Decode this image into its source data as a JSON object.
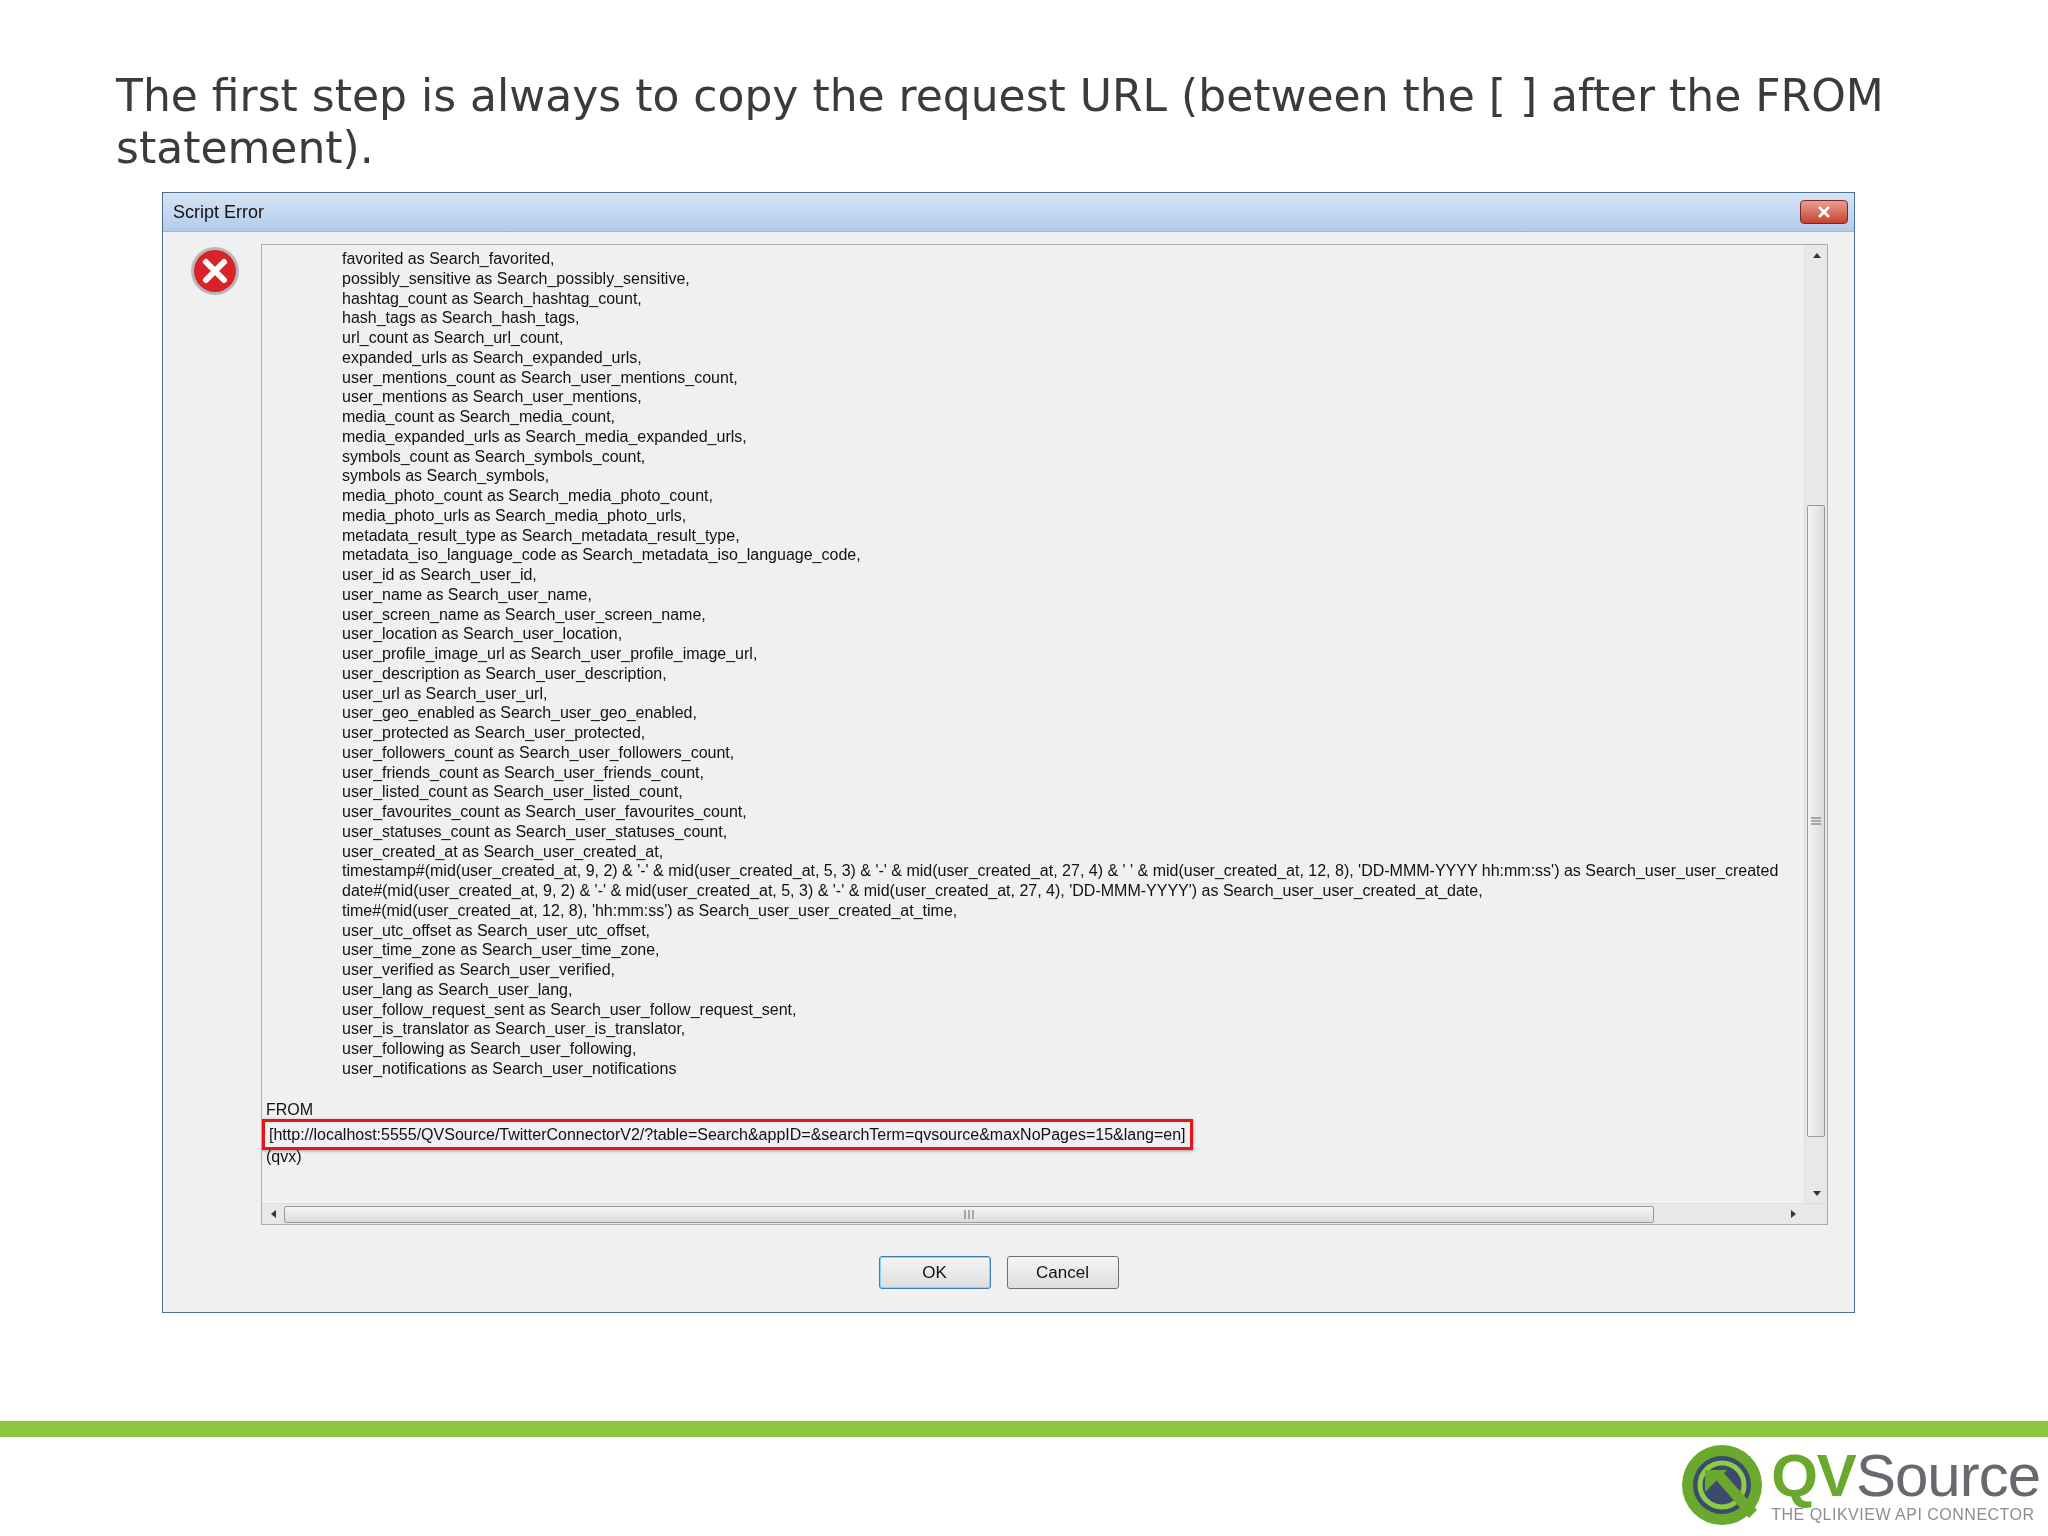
{
  "slide": {
    "heading": "The first step is always to copy the request URL (between the [ ] after the FROM statement)."
  },
  "dialog": {
    "title": "Script Error",
    "script_lines": [
      "favorited as Search_favorited,",
      "possibly_sensitive as Search_possibly_sensitive,",
      "hashtag_count as Search_hashtag_count,",
      "hash_tags as Search_hash_tags,",
      "url_count as Search_url_count,",
      "expanded_urls as Search_expanded_urls,",
      "user_mentions_count as Search_user_mentions_count,",
      "user_mentions as Search_user_mentions,",
      "media_count as Search_media_count,",
      "media_expanded_urls as Search_media_expanded_urls,",
      "symbols_count as Search_symbols_count,",
      "symbols as Search_symbols,",
      "media_photo_count as Search_media_photo_count,",
      "media_photo_urls as Search_media_photo_urls,",
      "metadata_result_type as Search_metadata_result_type,",
      "metadata_iso_language_code as Search_metadata_iso_language_code,",
      "user_id as Search_user_id,",
      "user_name as Search_user_name,",
      "user_screen_name as Search_user_screen_name,",
      "user_location as Search_user_location,",
      "user_profile_image_url as Search_user_profile_image_url,",
      "user_description as Search_user_description,",
      "user_url as Search_user_url,",
      "user_geo_enabled as Search_user_geo_enabled,",
      "user_protected as Search_user_protected,",
      "user_followers_count as Search_user_followers_count,",
      "user_friends_count as Search_user_friends_count,",
      "user_listed_count as Search_user_listed_count,",
      "user_favourites_count as Search_user_favourites_count,",
      "user_statuses_count as Search_user_statuses_count,",
      "user_created_at as Search_user_created_at,",
      "timestamp#(mid(user_created_at, 9, 2) & '-' & mid(user_created_at, 5, 3) & '-' & mid(user_created_at, 27, 4) & ' ' & mid(user_created_at, 12, 8), 'DD-MMM-YYYY hh:mm:ss') as Search_user_user_created",
      "date#(mid(user_created_at, 9, 2) & '-' & mid(user_created_at, 5, 3) & '-' & mid(user_created_at, 27, 4), 'DD-MMM-YYYY') as Search_user_user_created_at_date,",
      "time#(mid(user_created_at, 12, 8), 'hh:mm:ss') as Search_user_user_created_at_time,",
      "user_utc_offset as Search_user_utc_offset,",
      "user_time_zone as Search_user_time_zone,",
      "user_verified as Search_user_verified,",
      "user_lang as Search_user_lang,",
      "user_follow_request_sent as Search_user_follow_request_sent,",
      "user_is_translator as Search_user_is_translator,",
      "user_following as Search_user_following,",
      "user_notifications as Search_user_notifications"
    ],
    "from_keyword": "FROM",
    "request_url": "[http://localhost:5555/QVSource/TwitterConnectorV2/?table=Search&appID=&searchTerm=qvsource&maxNoPages=15&lang=en]",
    "url_highlighted": true,
    "trailing": "(qvx)",
    "buttons": [
      {
        "label": "OK",
        "default": true
      },
      {
        "label": "Cancel",
        "default": false
      }
    ]
  },
  "logo": {
    "name_part_1": "QV",
    "name_part_2": "Source",
    "tagline": "THE QLIKVIEW API CONNECTOR"
  }
}
